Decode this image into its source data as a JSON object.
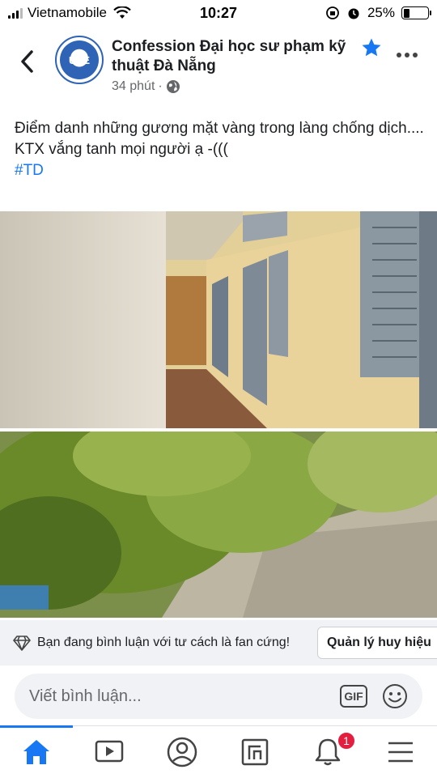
{
  "status_bar": {
    "carrier": "Vietnamobile",
    "time": "10:27",
    "battery": "25%",
    "battery_level": 0.25
  },
  "post": {
    "page_name": "Confession Đại học sư phạm kỹ thuật Đà Nẵng",
    "avatar_text": "UTE",
    "time_ago": "34 phút",
    "separator": "·",
    "text_line1": "Điểm danh những gương mặt vàng trong làng chống dịch....",
    "text_line2": "KTX vắng tanh mọi người ạ -(((",
    "hashtag": "#TD"
  },
  "fan_bar": {
    "text": "Bạn đang bình luận với tư cách là fan cứng!",
    "manage_label": "Quản lý huy hiệu"
  },
  "comment": {
    "placeholder": "Viết bình luận...",
    "gif_label": "GIF"
  },
  "nav": {
    "notifications_badge": "1"
  },
  "colors": {
    "accent": "#1877f2",
    "badge": "#e41e3f",
    "star": "#1877f2"
  },
  "icons": [
    "back-icon",
    "star-icon",
    "more-icon",
    "globe-icon",
    "diamond-icon",
    "gif-icon",
    "emoji-icon",
    "home-icon",
    "video-icon",
    "profile-icon",
    "pages-icon",
    "bell-icon",
    "menu-icon"
  ]
}
